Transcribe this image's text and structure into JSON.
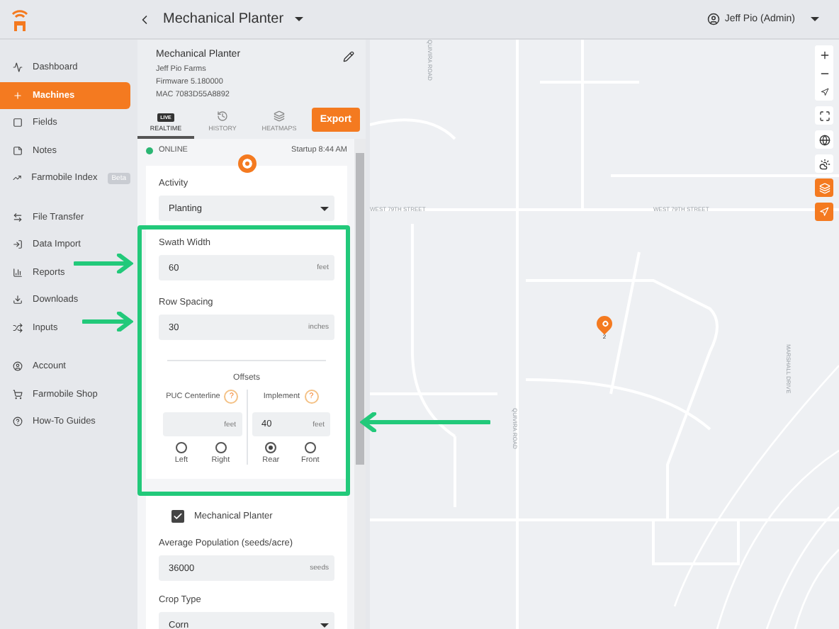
{
  "header": {
    "title": "Mechanical Planter",
    "user": "Jeff Pio (Admin)"
  },
  "sidebar": {
    "groups": [
      [
        {
          "label": "Dashboard",
          "selected": false
        },
        {
          "label": "Machines",
          "selected": true
        },
        {
          "label": "Fields",
          "selected": false
        },
        {
          "label": "Notes",
          "selected": false
        },
        {
          "label": "Farmobile Index",
          "selected": false,
          "badge": "Beta"
        }
      ],
      [
        {
          "label": "File Transfer",
          "selected": false
        },
        {
          "label": "Data Import",
          "selected": false
        },
        {
          "label": "Reports",
          "selected": false
        },
        {
          "label": "Downloads",
          "selected": false
        },
        {
          "label": "Inputs",
          "selected": false
        }
      ],
      [
        {
          "label": "Account",
          "selected": false
        },
        {
          "label": "Farmobile Shop",
          "selected": false
        },
        {
          "label": "How-To Guides",
          "selected": false
        }
      ]
    ]
  },
  "machine": {
    "name": "Mechanical Planter",
    "farm": "Jeff Pio Farms",
    "firmware": "Firmware 5.180000",
    "mac": "MAC 7083D55A8892"
  },
  "tabs": [
    {
      "label": "REALTIME",
      "badge": "LIVE",
      "selected": true
    },
    {
      "label": "HISTORY",
      "selected": false
    },
    {
      "label": "HEATMAPS",
      "selected": false
    }
  ],
  "export_button": "Export",
  "status": {
    "label": "ONLINE",
    "online": true,
    "startup": "Startup 8:44 AM"
  },
  "activity": {
    "label": "Activity",
    "value": "Planting"
  },
  "swath_width": {
    "label": "Swath Width",
    "value": "60",
    "unit": "feet"
  },
  "row_spacing": {
    "label": "Row Spacing",
    "value": "30",
    "unit": "inches"
  },
  "offsets": {
    "title": "Offsets",
    "columns": [
      {
        "label": "PUC Centerline",
        "help": "?",
        "unit": "feet",
        "options": [
          {
            "label": "Left",
            "selected": false
          },
          {
            "label": "Right",
            "selected": false
          }
        ]
      },
      {
        "label": "Implement",
        "help": "?",
        "value": "40",
        "unit": "feet",
        "options": [
          {
            "label": "Rear",
            "selected": true
          },
          {
            "label": "Front",
            "selected": false
          }
        ]
      }
    ]
  },
  "implement_checkbox": {
    "label": "Mechanical Planter",
    "checked": true
  },
  "population": {
    "label": "Average Population (seeds/acre)",
    "value": "36000",
    "unit": "seeds"
  },
  "crop_type": {
    "label": "Crop Type",
    "value": "Corn"
  },
  "map": {
    "labels": [
      "WEST 79TH STREET",
      "WEST 79TH STREET",
      "QUIVIRA ROAD",
      "QUIVIRA ROAD",
      "MARSHALL DRIVE"
    ],
    "marker": "2"
  }
}
